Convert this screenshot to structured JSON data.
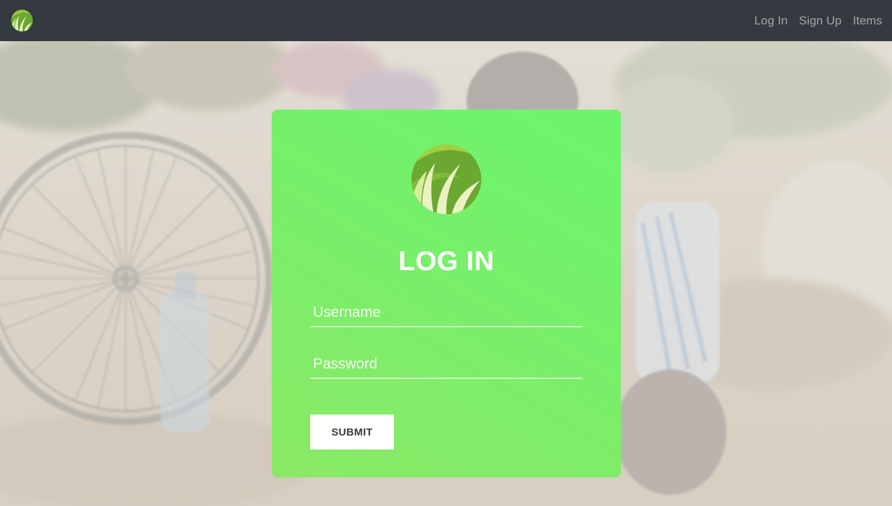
{
  "navbar": {
    "brand_icon": "grass-logo-icon",
    "links": [
      {
        "label": "Log In"
      },
      {
        "label": "Sign Up"
      },
      {
        "label": "Items"
      }
    ]
  },
  "login_card": {
    "logo_icon": "grass-logo-icon",
    "title": "LOG IN",
    "username_placeholder": "Username",
    "username_value": "",
    "password_placeholder": "Password",
    "password_value": "",
    "submit_label": "SUBMIT"
  },
  "colors": {
    "navbar_bg": "#343a40",
    "nav_link": "#a1a4a7",
    "card_green": "#78ef6a",
    "button_bg": "#ffffff",
    "logo_dark_green": "#6aa832",
    "logo_light": "#eaf2c2"
  }
}
